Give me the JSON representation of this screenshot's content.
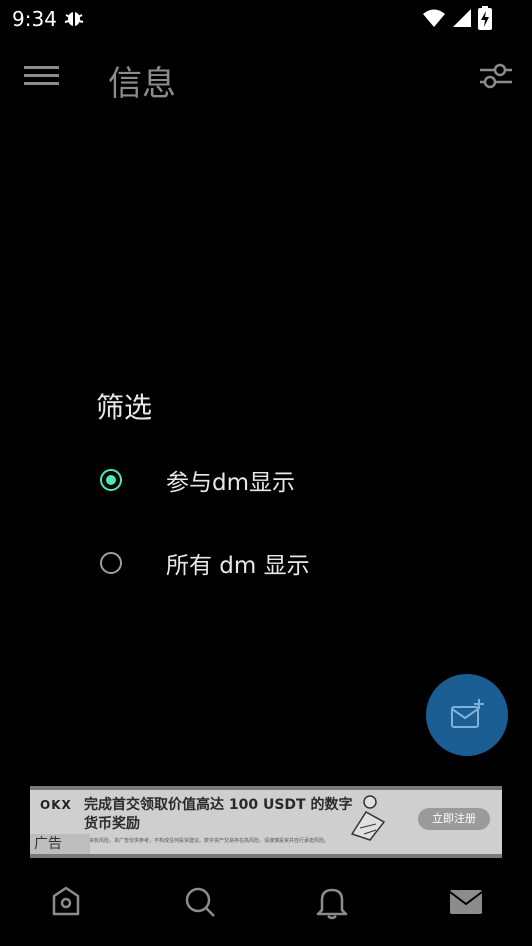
{
  "status_bar": {
    "time": "9:34",
    "app_icon": "bug-icon",
    "indicators": [
      "wifi-icon",
      "signal-icon",
      "battery-charging-icon"
    ]
  },
  "app_bar": {
    "title": "信息",
    "menu_icon": "hamburger-menu-icon",
    "filter_icon": "filter-sliders-icon"
  },
  "filter_dialog": {
    "title": "筛选",
    "options": [
      {
        "label": "参与dm显示",
        "selected": true
      },
      {
        "label": "所有 dm 显示",
        "selected": false
      }
    ],
    "accent_color": "#4de8b5"
  },
  "fab": {
    "icon": "new-message-icon",
    "color": "#1a5e94"
  },
  "ad": {
    "brand": "OKX",
    "headline": "完成首交领取价值高达 100 USDT 的数字货币奖励",
    "fine_print": "投资有风险，本广告仅供参考，不构成任何投资建议。数字资产交易存在高风险，请谨慎投资并自行承担风险。",
    "cta": "立即注册",
    "label": "广告"
  },
  "bottom_nav": [
    {
      "name": "home",
      "icon": "home-icon"
    },
    {
      "name": "search",
      "icon": "search-icon"
    },
    {
      "name": "notifications",
      "icon": "bell-icon"
    },
    {
      "name": "messages",
      "icon": "mail-icon",
      "active": true
    }
  ]
}
